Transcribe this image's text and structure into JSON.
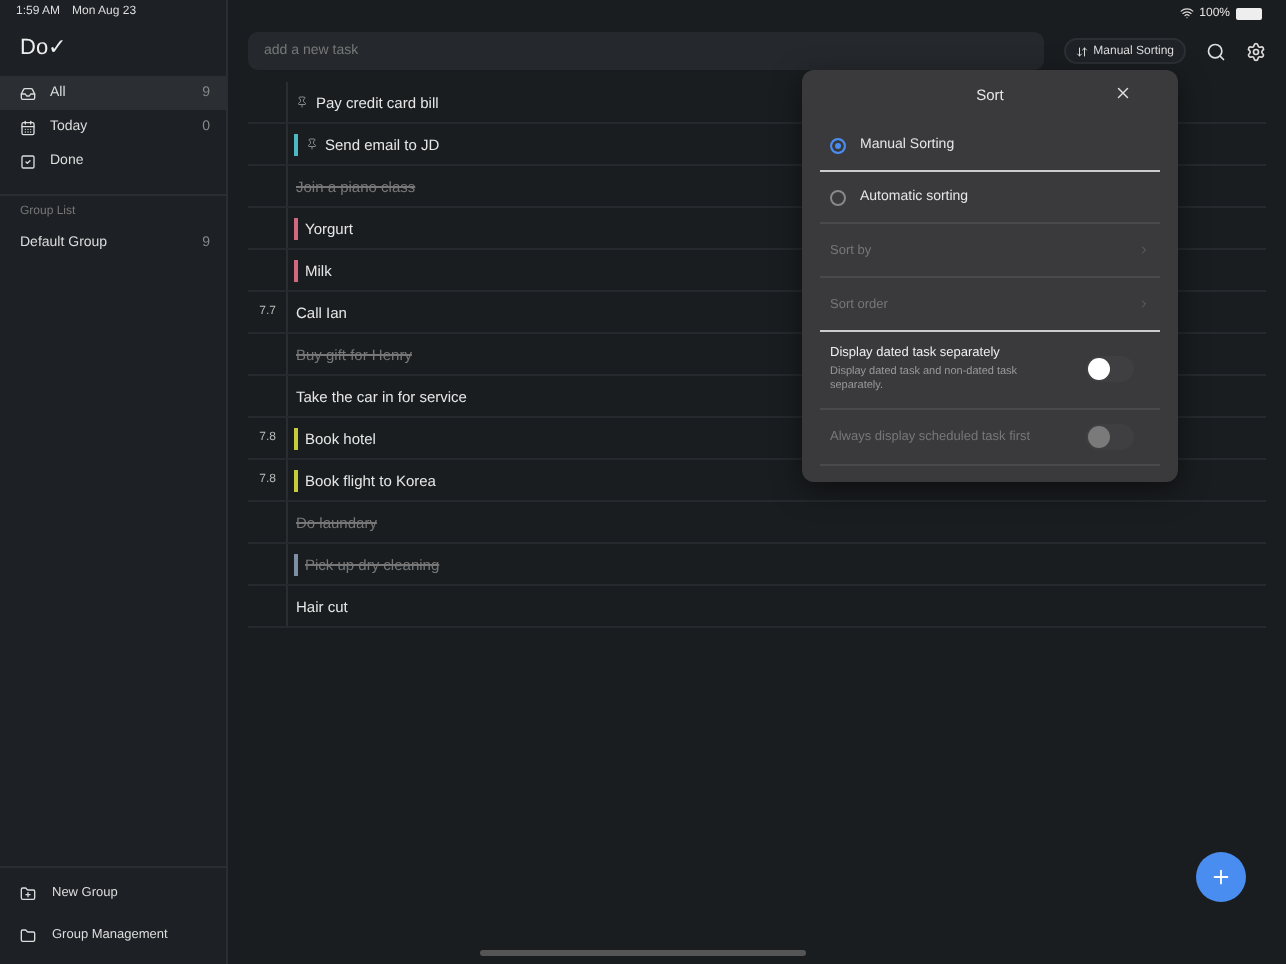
{
  "status_bar": {
    "time": "1:59 AM",
    "date": "Mon Aug 23",
    "battery": "100%"
  },
  "app": {
    "logo": "Do✓"
  },
  "sidebar": {
    "items": [
      {
        "label": "All",
        "count": "9",
        "selected": true
      },
      {
        "label": "Today",
        "count": "0",
        "selected": false
      },
      {
        "label": "Done",
        "selected": false
      }
    ],
    "group_list_title": "Group List",
    "groups": [
      {
        "label": "Default Group",
        "count": "9",
        "selected": false
      }
    ],
    "footer": [
      {
        "label": "New Group"
      },
      {
        "label": "Group Management"
      }
    ]
  },
  "toolbar": {
    "placeholder": "add a new task",
    "sort_button": "Manual Sorting"
  },
  "tasks": [
    {
      "title": "Pay credit card bill",
      "pinned": true,
      "done": false
    },
    {
      "title": "Send email to JD",
      "pinned": true,
      "done": false,
      "color": "#4fb6c4"
    },
    {
      "title": "Join a piano class",
      "pinned": false,
      "done": true
    },
    {
      "title": "Yorgurt",
      "pinned": false,
      "done": false,
      "color": "#d0687e"
    },
    {
      "title": "Milk",
      "pinned": false,
      "done": false,
      "color": "#d0687e"
    },
    {
      "title": "Call Ian",
      "pinned": false,
      "done": false,
      "score": "7.7"
    },
    {
      "title": "Buy gift for Henry",
      "pinned": false,
      "done": true
    },
    {
      "title": "Take the car in for service",
      "pinned": false,
      "done": false
    },
    {
      "title": "Book hotel",
      "pinned": false,
      "done": false,
      "color": "#c9c93c",
      "score": "7.8"
    },
    {
      "title": "Book flight to Korea",
      "pinned": false,
      "done": false,
      "color": "#c9c93c",
      "score": "7.8"
    },
    {
      "title": "Do laundary",
      "pinned": false,
      "done": true
    },
    {
      "title": "Pick up dry cleaning",
      "pinned": false,
      "done": true,
      "color": "#7d8ea6"
    },
    {
      "title": "Hair cut",
      "pinned": false,
      "done": false
    }
  ],
  "sort_popover": {
    "title": "Sort",
    "options": [
      {
        "label": "Manual Sorting",
        "selected": true
      },
      {
        "label": "Automatic sorting",
        "selected": false
      }
    ],
    "settings": [
      {
        "label": "Sort by",
        "disabled": true
      },
      {
        "label": "Sort order",
        "disabled": true
      }
    ],
    "toggles": [
      {
        "label": "Display dated task separately",
        "description": "Display dated task and non-dated task separately.",
        "on": false,
        "disabled": false
      },
      {
        "label": "Always display scheduled task first",
        "on": false,
        "disabled": true
      }
    ]
  }
}
